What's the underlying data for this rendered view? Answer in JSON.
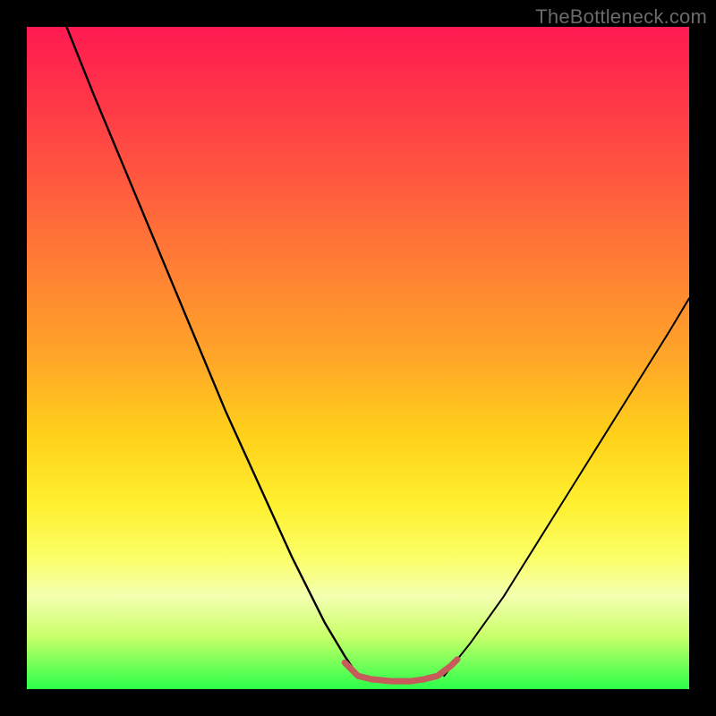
{
  "watermark": "TheBottleneck.com",
  "chart_data": {
    "type": "line",
    "title": "",
    "xlabel": "",
    "ylabel": "",
    "xlim": [
      0,
      100
    ],
    "ylim": [
      0,
      100
    ],
    "grid": false,
    "legend": false,
    "annotations": [],
    "gradient_stops": [
      {
        "pos": 0,
        "color": "#ff1a52"
      },
      {
        "pos": 22,
        "color": "#ff5540"
      },
      {
        "pos": 50,
        "color": "#ffa628"
      },
      {
        "pos": 72,
        "color": "#ffef2f"
      },
      {
        "pos": 92,
        "color": "#c9ff6a"
      },
      {
        "pos": 100,
        "color": "#2aff4a"
      }
    ],
    "series": [
      {
        "name": "left-descending-curve",
        "color": "#000000",
        "x": [
          6,
          10,
          15,
          20,
          25,
          30,
          35,
          40,
          45,
          48,
          50
        ],
        "y": [
          100,
          90,
          78,
          66,
          54,
          42,
          31,
          20,
          10,
          5,
          2
        ]
      },
      {
        "name": "valley-floor",
        "color": "#c75a5a",
        "x": [
          48,
          50,
          52,
          55,
          58,
          60,
          62,
          64,
          65
        ],
        "y": [
          4,
          2,
          1.5,
          1.2,
          1.2,
          1.5,
          2,
          3.5,
          4.5
        ]
      },
      {
        "name": "right-ascending-curve",
        "color": "#000000",
        "x": [
          63,
          67,
          72,
          77,
          82,
          87,
          92,
          97,
          100
        ],
        "y": [
          2,
          7,
          14,
          22,
          30,
          38,
          46,
          54,
          59
        ]
      }
    ]
  }
}
